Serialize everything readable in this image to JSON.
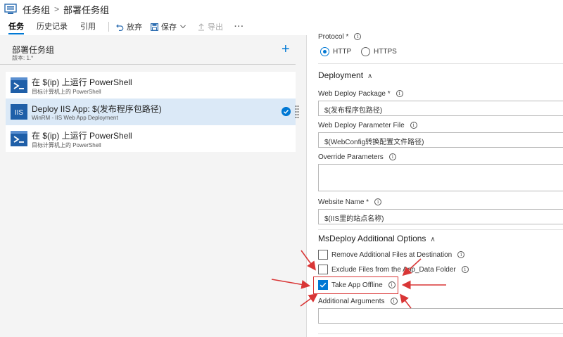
{
  "breadcrumb": {
    "root": "任务组",
    "separator": ">",
    "current": "部署任务组"
  },
  "toolbar": {
    "tabs": [
      "任务",
      "历史记录",
      "引用"
    ],
    "discard_label": "放弃",
    "save_label": "保存",
    "export_label": "导出",
    "more_label": "···"
  },
  "left_panel": {
    "title": "部署任务组",
    "version": "版本: 1.*",
    "add_label": "+",
    "tasks": [
      {
        "name": "在 $(ip) 上运行 PowerShell",
        "subtitle": "目标计算机上的 PowerShell",
        "icon": "powershell-icon"
      },
      {
        "name": "Deploy IIS App: $(发布程序包路径)",
        "subtitle": "WinRM - IIS Web App Deployment",
        "icon": "iis-icon"
      },
      {
        "name": "在 $(ip) 上运行 PowerShell",
        "subtitle": "目标计算机上的 PowerShell",
        "icon": "powershell-icon"
      }
    ]
  },
  "right_panel": {
    "protocol_label": "Protocol *",
    "protocol_options": [
      "HTTP",
      "HTTPS"
    ],
    "protocol_selected": "HTTP",
    "deployment_section": "Deployment",
    "web_deploy_package_label": "Web Deploy Package *",
    "web_deploy_package_value": "$(发布程序包路径)",
    "web_deploy_param_label": "Web Deploy Parameter File",
    "web_deploy_param_value": "$(WebConfig转换配置文件路径)",
    "override_params_label": "Override Parameters",
    "override_params_value": "",
    "website_name_label": "Website Name *",
    "website_name_value": "$(IIS里的站点名称)",
    "msdeploy_section": "MsDeploy Additional Options",
    "remove_files_label": "Remove Additional Files at Destination",
    "exclude_files_label": "Exclude Files from the App_Data Folder",
    "take_offline_label": "Take App Offline",
    "take_offline_checked": true,
    "additional_args_label": "Additional Arguments",
    "additional_args_value": "",
    "info_glyph": "i"
  },
  "colors": {
    "accent": "#0078d4",
    "annotation": "#d93636"
  }
}
